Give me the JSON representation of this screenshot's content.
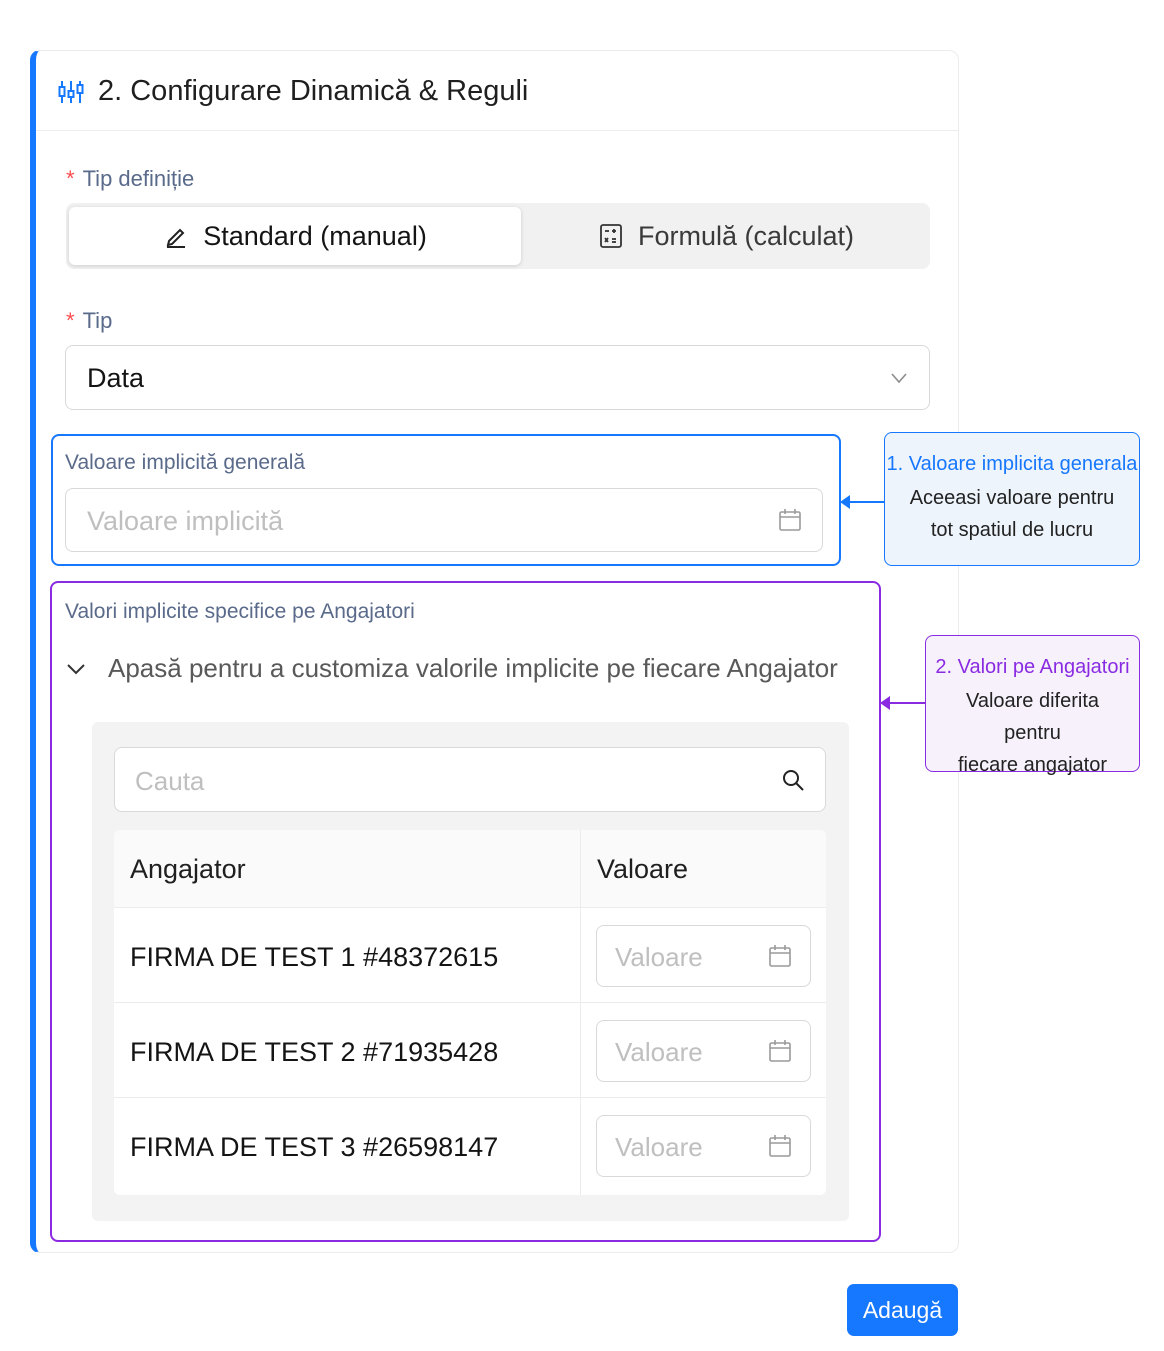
{
  "card": {
    "title": "2. Configurare Dinamică & Reguli",
    "icon": "sliders-icon"
  },
  "definition_type": {
    "label": "Tip definiție",
    "required_mark": "*",
    "options": [
      {
        "label": "Standard (manual)",
        "icon": "edit-icon",
        "selected": true
      },
      {
        "label": "Formulă (calculat)",
        "icon": "calculator-icon",
        "selected": false
      }
    ]
  },
  "type_field": {
    "label": "Tip",
    "required_mark": "*",
    "value": "Data"
  },
  "general_default": {
    "label": "Valoare implicită generală",
    "placeholder": "Valoare implicită"
  },
  "employer_defaults": {
    "label": "Valori implicite specifice pe Angajatori",
    "collapse_text": "Apasă pentru a customiza valorile implicite pe fiecare Angajator",
    "search_placeholder": "Cauta",
    "columns": [
      "Angajator",
      "Valoare"
    ],
    "rows": [
      {
        "name": "FIRMA DE TEST 1 #48372615",
        "placeholder": "Valoare"
      },
      {
        "name": "FIRMA DE TEST 2 #71935428",
        "placeholder": "Valoare"
      },
      {
        "name": "FIRMA DE TEST 3 #26598147",
        "placeholder": "Valoare"
      }
    ]
  },
  "callouts": {
    "blue": {
      "title": "1. Valoare implicita generala",
      "line1": "Aceeasi valoare pentru",
      "line2": "tot spatiul de lucru"
    },
    "purple": {
      "title": "2. Valori pe Angajatori",
      "line1": "Valoare diferita pentru",
      "line2": "fiecare angajator"
    }
  },
  "actions": {
    "add_label": "Adaugă"
  },
  "colors": {
    "primary": "#1677ff",
    "purple": "#8a2be2",
    "required": "#ff4d4f"
  }
}
